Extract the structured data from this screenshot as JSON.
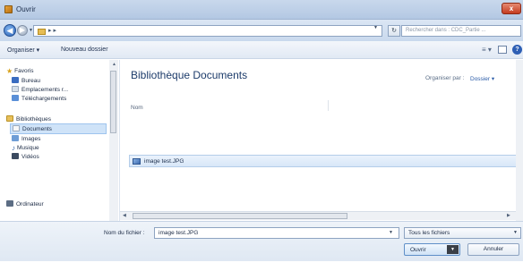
{
  "window": {
    "title": "Ouvrir",
    "close_glyph": "x"
  },
  "address": {
    "back_glyph": "◀",
    "forward_glyph": "▶",
    "path_arrows": "▸ ▸",
    "refresh_glyph": "↻",
    "search_placeholder": "Rechercher dans : CDC_Partie ..."
  },
  "toolbar": {
    "organize_label": "Organiser ▾",
    "new_folder_label": "Nouveau dossier",
    "views_glyph": "≡ ▾",
    "help_glyph": "?"
  },
  "nav": {
    "favorites": "Favoris",
    "desktop": "Bureau",
    "recent": "Emplacements r...",
    "downloads": "Téléchargements",
    "libraries": "Bibliothèques",
    "documents": "Documents",
    "images": "Images",
    "music": "Musique",
    "videos": "Vidéos",
    "computer": "Ordinateur"
  },
  "main": {
    "library_title": "Bibliothèque Documents",
    "arrange_label": "Organiser par :",
    "arrange_value": "Dossier ▾",
    "column_name": "Nom",
    "files": [
      {
        "name": "image test.JPG"
      }
    ]
  },
  "bottom": {
    "filename_label": "Nom du fichier :",
    "filename_value": "image test.JPG",
    "filetype_value": "Tous les fichiers",
    "open_label": "Ouvrir",
    "cancel_label": "Annuler"
  },
  "icons": {
    "app": "folder-icon",
    "favorites": "star-icon",
    "desktop": "desktop-icon",
    "recent": "recent-places-icon",
    "downloads": "downloads-icon",
    "libraries": "library-icon",
    "documents": "document-icon",
    "images": "image-icon",
    "music": "music-icon",
    "videos": "video-icon",
    "computer": "computer-icon",
    "file": "image-file-icon"
  }
}
